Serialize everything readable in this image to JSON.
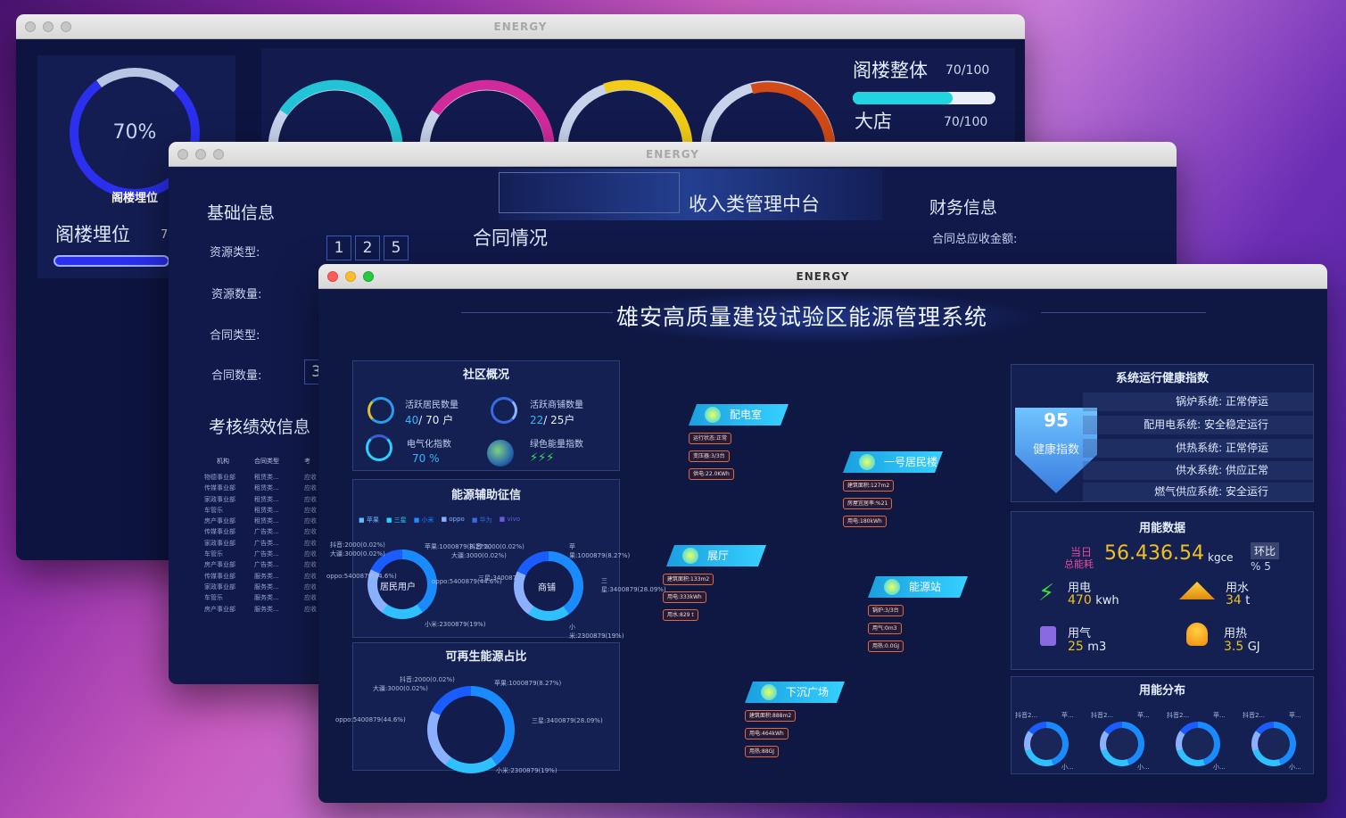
{
  "win1": {
    "title": "ENERGY",
    "gauge_pct": "70%",
    "gauge_label": "阁楼埋位",
    "bar_label": "阁楼埋位",
    "bar_value_short": "7",
    "overall_label": "阁楼整体",
    "overall_value": "70/100",
    "overall_progress": 0.7,
    "store_label": "大店",
    "store_value": "70/100"
  },
  "win2": {
    "title": "ENERGY",
    "banner": "收入类管理中台",
    "basic_info": "基础信息",
    "contract_status": "合同情况",
    "finance_info": "财务信息",
    "finance_total": "合同总应收金额:",
    "resource_type": "资源类型:",
    "resource_digits": [
      "1",
      "2",
      "5"
    ],
    "resource_count": "资源数量:",
    "contract_type": "合同类型:",
    "contract_count": "合同数量:",
    "contract_count_partial": "3",
    "assessment": "考核绩效信息",
    "table": {
      "headers": [
        "机构",
        "合同类型",
        "考"
      ],
      "rows": [
        [
          "物德事业部",
          "租赁类...",
          "应收"
        ],
        [
          "传媒事业部",
          "租赁类...",
          "应收"
        ],
        [
          "家政事业部",
          "租赁类...",
          "应收"
        ],
        [
          "车管乐",
          "租赁类...",
          "应收"
        ],
        [
          "房产事业部",
          "租赁类...",
          "应收"
        ],
        [
          "传媒事业部",
          "广告类...",
          "应收"
        ],
        [
          "家政事业部",
          "广告类...",
          "应收"
        ],
        [
          "车管乐",
          "广告类...",
          "应收"
        ],
        [
          "房产事业部",
          "广告类...",
          "应收"
        ],
        [
          "传媒事业部",
          "服务类...",
          "应收"
        ],
        [
          "家政事业部",
          "服务类...",
          "应收"
        ],
        [
          "车管乐",
          "服务类...",
          "应收"
        ],
        [
          "房产事业部",
          "服务类...",
          "应收"
        ]
      ]
    }
  },
  "win3": {
    "title": "ENERGY",
    "main_title": "雄安高质量建设试验区能源管理系统",
    "community": {
      "title": "社区概况",
      "residents_label": "活跃居民数量",
      "residents_value": "40",
      "residents_total": "/ 70 户",
      "shops_label": "活跃商铺数量",
      "shops_value": "22",
      "shops_total": "/ 25户",
      "elec_label": "电气化指数",
      "elec_value": "70 %",
      "green_label": "绿色能量指数",
      "green_value": "⚡⚡⚡"
    },
    "aux": {
      "title": "能源辅助征信",
      "legend": [
        "■ 苹果",
        "■ 三星",
        "■ 小米",
        "■ oppo",
        "■ 华为",
        "■ vivo"
      ],
      "donut1_label": "居民用户",
      "donut2_label": "商铺",
      "d1_ann": [
        "抖音:2000(0.02%)",
        "大疆:3000(0.02%)",
        "苹果:1000879(8.27%)",
        "三星:3400879(28",
        "oppo:5400879(44.6%)",
        "小米:2300879(19%)"
      ],
      "d2_ann": [
        "抖音:2000(0.02%)",
        "大疆:3000(0.02%)",
        "苹果:1000879(8.27%)",
        "三星:3400879(28.09%)",
        "oppo:5400879(44.6%)",
        "小米:2300879(19%)"
      ]
    },
    "renew": {
      "title": "可再生能源占比",
      "ann": [
        "抖音:2000(0.02%)",
        "大疆:3000(0.02%)",
        "苹果:1000879(8.27%)",
        "oppo:5400879(44.6%)",
        "三星:3400879(28.09%)",
        "小米:2300879(19%)"
      ]
    },
    "map": {
      "nodes": [
        {
          "name": "配电室",
          "tags": [
            "运行状态:正常",
            "变压器:3/3台",
            "供电:22.0KWh"
          ]
        },
        {
          "name": "一号居民楼",
          "tags": [
            "建筑面积:127m2",
            "房屋宜居率:%21",
            "用电:180kWh"
          ]
        },
        {
          "name": "展厅",
          "tags": [
            "建筑面积:133m2",
            "用电:333kWh",
            "用水:829 t"
          ]
        },
        {
          "name": "能源站",
          "tags": [
            "锅炉:3/3台",
            "用气:0m3",
            "用热:0.0GJ"
          ]
        },
        {
          "name": "下沉广场",
          "tags": [
            "建筑面积:888m2",
            "用电:464kWh",
            "用热:88GJ"
          ]
        }
      ]
    },
    "health": {
      "title": "系统运行健康指数",
      "score": "95",
      "score_label": "健康指数",
      "rows": [
        "锅炉系统:  正常停运",
        "配用电系统:  安全稳定运行",
        "供热系统:  正常停运",
        "供水系统:  供应正常",
        "燃气供应系统:  安全运行"
      ]
    },
    "usage": {
      "title": "用能数据",
      "today_l1": "当日",
      "today_l2": "总能耗",
      "total": "56.436.54",
      "unit": "kgce",
      "ratio_label": "环比",
      "ratio_value": "% 5",
      "elec_label": "用电",
      "elec_value": "470",
      "elec_unit": "kwh",
      "water_label": "用水",
      "water_value": "34",
      "water_unit": "t",
      "gas_label": "用气",
      "gas_value": "25",
      "gas_unit": "m3",
      "heat_label": "用热",
      "heat_value": "3.5",
      "heat_unit": "GJ"
    },
    "dist": {
      "title": "用能分布",
      "labels": [
        "抖音2...",
        "苹...",
        "抖音2...",
        "苹...",
        "抖音2...",
        "苹...",
        "抖音2...",
        "苹..."
      ],
      "bottom": [
        "小...",
        "小...",
        "小...",
        "小..."
      ]
    }
  }
}
